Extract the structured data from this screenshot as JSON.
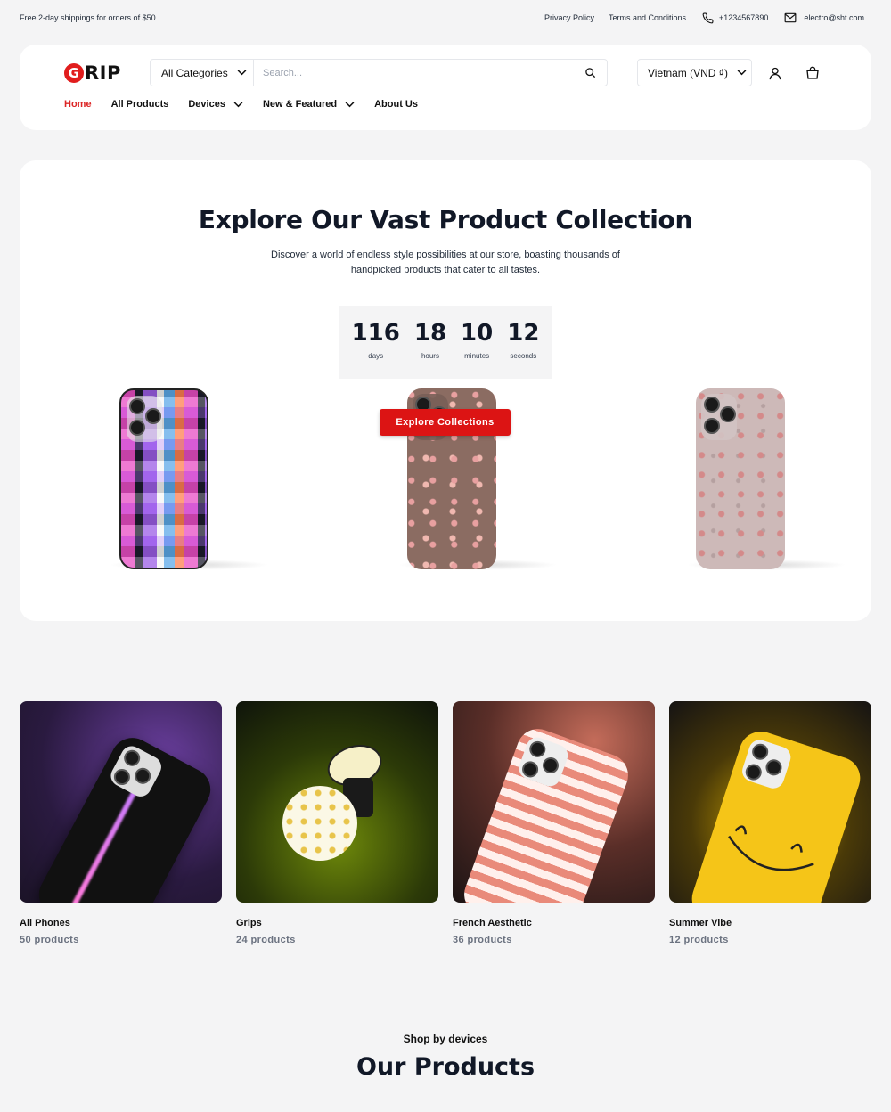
{
  "topbar": {
    "promo": "Free 2-day shippings for orders of $50",
    "privacy": "Privacy Policy",
    "terms": "Terms and Conditions",
    "phone": "+1234567890",
    "email": "electro@sht.com"
  },
  "header": {
    "logo_initial": "G",
    "logo_rest": "RIP",
    "category_select": "All Categories",
    "search_placeholder": "Search...",
    "currency": "Vietnam (VND ₫)"
  },
  "nav": {
    "items": [
      {
        "label": "Home",
        "active": true
      },
      {
        "label": "All Products"
      },
      {
        "label": "Devices"
      },
      {
        "label": "New & Featured"
      },
      {
        "label": "About Us"
      }
    ]
  },
  "hero": {
    "title": "Explore Our Vast Product Collection",
    "description": "Discover a world of endless style possibilities at our store, boasting thousands of handpicked products that cater to all tastes.",
    "countdown": {
      "days": "116",
      "days_label": "days",
      "hours": "18",
      "hours_label": "hours",
      "minutes": "10",
      "minutes_label": "minutes",
      "seconds": "12",
      "seconds_label": "seconds"
    },
    "cta": "Explore Collections"
  },
  "categories": [
    {
      "name": "All Phones",
      "count": "50 products"
    },
    {
      "name": "Grips",
      "count": "24 products"
    },
    {
      "name": "French Aesthetic",
      "count": "36 products"
    },
    {
      "name": "Summer Vibe",
      "count": "12 products"
    }
  ],
  "section": {
    "subtitle": "Shop by devices",
    "title": "Our Products"
  },
  "colors": {
    "accent": "#dc2626",
    "cta": "#dc1414",
    "background": "#f4f4f5"
  }
}
